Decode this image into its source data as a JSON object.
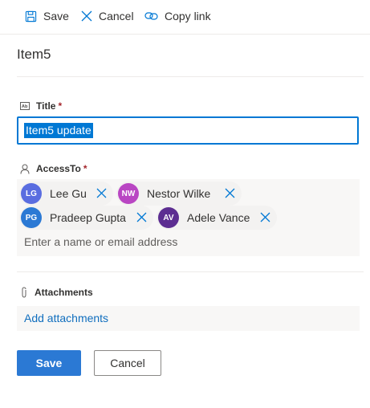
{
  "toolbar": {
    "save_label": "Save",
    "cancel_label": "Cancel",
    "copy_link_label": "Copy link"
  },
  "item": {
    "title": "Item5"
  },
  "fields": {
    "title": {
      "label": "Title",
      "required_mark": "*",
      "value": "Item5 update",
      "icon": "text-field-icon"
    },
    "access_to": {
      "label": "AccessTo",
      "required_mark": "*",
      "icon": "person-icon",
      "people": [
        {
          "initials": "LG",
          "name": "Lee Gu",
          "color": "#5a6de0"
        },
        {
          "initials": "NW",
          "name": "Nestor Wilke",
          "color": "#b946c3"
        },
        {
          "initials": "PG",
          "name": "Pradeep Gupta",
          "color": "#2b79d4"
        },
        {
          "initials": "AV",
          "name": "Adele Vance",
          "color": "#5c2d91"
        }
      ],
      "placeholder": "Enter a name or email address"
    },
    "attachments": {
      "label": "Attachments",
      "icon": "paperclip-icon",
      "add_link": "Add attachments"
    }
  },
  "footer": {
    "save_label": "Save",
    "cancel_label": "Cancel"
  },
  "colors": {
    "accent": "#0078d4",
    "primary_button": "#2b79d4",
    "required": "#a4262c",
    "link": "#106ebe"
  }
}
